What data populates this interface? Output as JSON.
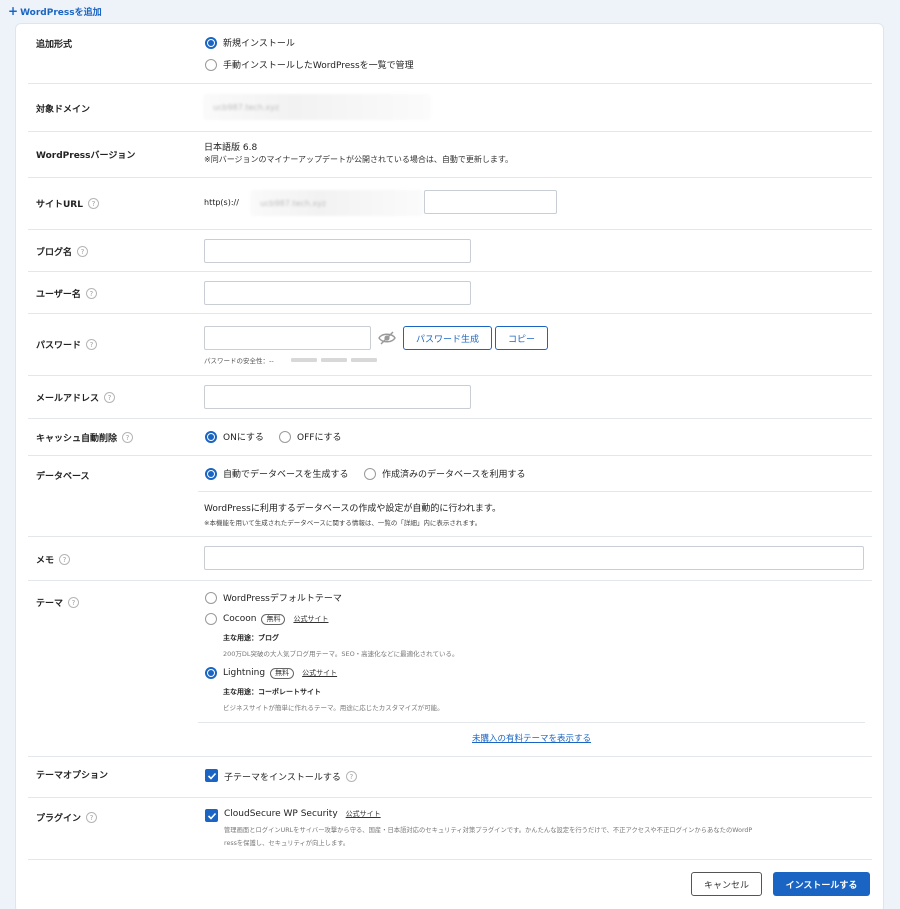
{
  "header": {
    "add_label": "WordPressを追加"
  },
  "rows": {
    "add_type": {
      "label": "追加形式",
      "option_new": "新規インストール",
      "option_manage": "手動インストールしたWordPressを一覧で管理"
    },
    "domain": {
      "label": "対象ドメイン",
      "value": "ucb987.tech.xyz"
    },
    "version": {
      "label": "WordPressバージョン",
      "value": "日本語版 6.8",
      "note": "※同バージョンのマイナーアップデートが公開されている場合は、自動で更新します。"
    },
    "site_url": {
      "label": "サイトURL",
      "prefix": "http(s)://",
      "domain_value": "ucb987.tech.xyz",
      "path_value": ""
    },
    "blog_name": {
      "label": "ブログ名",
      "value": ""
    },
    "username": {
      "label": "ユーザー名",
      "value": ""
    },
    "password": {
      "label": "パスワード",
      "value": "",
      "generate_label": "パスワード生成",
      "copy_label": "コピー",
      "strength_label": "パスワードの安全性：--"
    },
    "email": {
      "label": "メールアドレス",
      "value": ""
    },
    "cache": {
      "label": "キャッシュ自動削除",
      "on_label": "ONにする",
      "off_label": "OFFにする"
    },
    "database": {
      "label": "データベース",
      "auto_label": "自動でデータベースを生成する",
      "existing_label": "作成済みのデータベースを利用する",
      "desc": "WordPressに利用するデータベースの作成や設定が自動的に行われます。",
      "note": "※本機能を用いて生成されたデータベースに関する情報は、一覧の「詳細」内に表示されます。"
    },
    "memo": {
      "label": "メモ",
      "value": ""
    },
    "theme": {
      "label": "テーマ",
      "default_label": "WordPressデフォルトテーマ",
      "cocoon": {
        "name": "Cocoon",
        "badge": "無料",
        "site_link": "公式サイト",
        "use": "主な用途：ブログ",
        "desc": "200万DL突破の大人気ブログ用テーマ。SEO・高速化などに最適化されている。"
      },
      "lightning": {
        "name": "Lightning",
        "badge": "無料",
        "site_link": "公式サイト",
        "use": "主な用途：コーポレートサイト",
        "desc": "ビジネスサイトが簡単に作れるテーマ。用途に応じたカスタマイズが可能。"
      },
      "paid_link": "未購入の有料テーマを表示する"
    },
    "theme_option": {
      "label": "テーマオプション",
      "child_label": "子テーマをインストールする"
    },
    "plugin": {
      "label": "プラグイン",
      "name": "CloudSecure WP Security",
      "site_link": "公式サイト",
      "desc1": "管理画面とログインURLをサイバー攻撃から守る、国産・日本語対応のセキュリティ対策プラグインです。かんたんな設定を行うだけで、不正アクセスや不正ログインからあなたのWordP",
      "desc2": "ressを保護し、セキュリティが向上します。"
    }
  },
  "footer": {
    "cancel_label": "キャンセル",
    "install_label": "インストールする"
  },
  "colors": {
    "accent": "#1a65c3",
    "border": "#e3e7ec"
  }
}
